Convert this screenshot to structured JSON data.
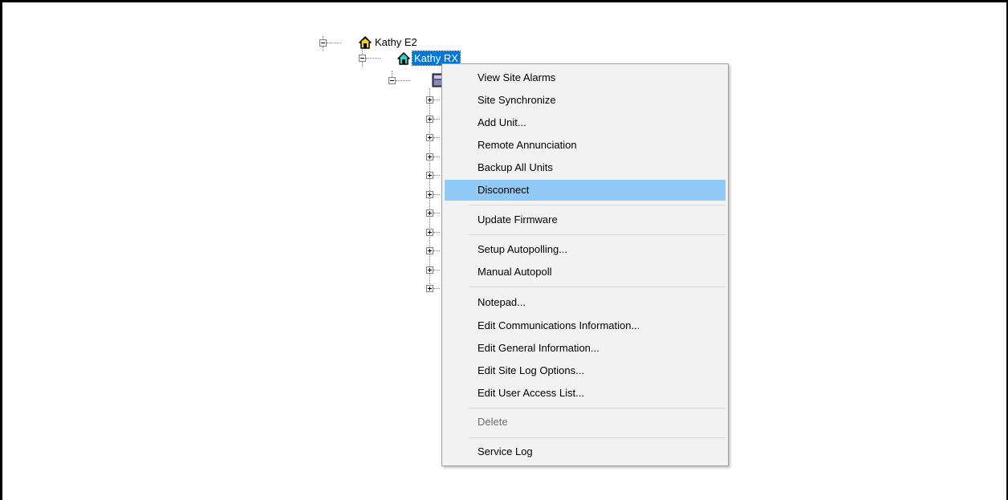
{
  "tree": {
    "root": {
      "label": "Kathy E2",
      "icon": "site-group-icon"
    },
    "site": {
      "label": "Kathy RX",
      "icon": "site-icon"
    },
    "controller": {
      "label": "",
      "icon": "controller-icon"
    },
    "collapsed_children_count": 11
  },
  "context_menu": {
    "items": [
      {
        "label": "View Site Alarms"
      },
      {
        "label": "Site Synchronize"
      },
      {
        "label": "Add Unit..."
      },
      {
        "label": "Remote Annunciation"
      },
      {
        "label": "Backup All Units"
      },
      {
        "label": "Disconnect",
        "highlighted": true
      },
      {
        "label": "Update Firmware"
      },
      {
        "label": "Setup Autopolling..."
      },
      {
        "label": "Manual Autopoll"
      },
      {
        "label": "Notepad..."
      },
      {
        "label": "Edit Communications Information..."
      },
      {
        "label": "Edit General Information..."
      },
      {
        "label": "Edit Site Log Options..."
      },
      {
        "label": "Edit User Access List..."
      },
      {
        "label": "Delete",
        "disabled": true
      },
      {
        "label": "Service Log"
      }
    ]
  },
  "colors": {
    "selection": "#0078d7",
    "menu_highlight": "#91c9f7",
    "menu_background": "#f2f2f2",
    "disabled_text": "#6d6d6d"
  }
}
